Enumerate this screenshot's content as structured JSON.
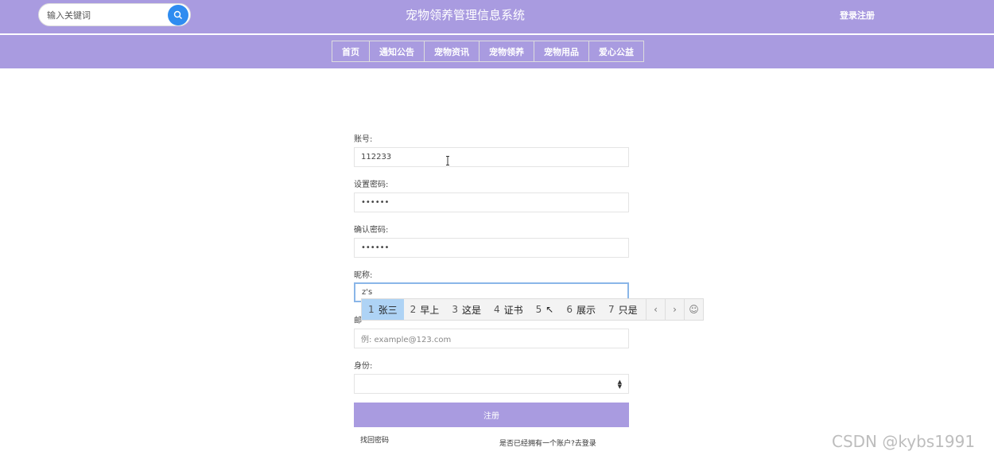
{
  "header": {
    "search_placeholder": "输入关键词",
    "title": "宠物领养管理信息系统",
    "login_register": "登录注册"
  },
  "nav": [
    "首页",
    "通知公告",
    "宠物资讯",
    "宠物领养",
    "宠物用品",
    "爱心公益"
  ],
  "form": {
    "account_label": "账号:",
    "account_value": "112233",
    "password_label": "设置密码:",
    "password_value": "••••••",
    "confirm_label": "确认密码:",
    "confirm_value": "••••••",
    "nickname_label": "昵称:",
    "nickname_value": "z's",
    "email_label": "邮",
    "email_placeholder": "例: example@123.com",
    "role_label": "身份:",
    "role_value": "",
    "submit_label": "注册",
    "forgot_link": "找回密码",
    "login_link": "是否已经拥有一个账户?去登录"
  },
  "ime": {
    "candidates": [
      {
        "num": "1",
        "text": "张三"
      },
      {
        "num": "2",
        "text": "早上"
      },
      {
        "num": "3",
        "text": "这是"
      },
      {
        "num": "4",
        "text": "证书"
      },
      {
        "num": "5",
        "text": "↖"
      },
      {
        "num": "6",
        "text": "展示"
      },
      {
        "num": "7",
        "text": "只是"
      }
    ],
    "prev": "‹",
    "next": "›",
    "emoji": "☺"
  },
  "watermark": "CSDN @kybs1991",
  "colors": {
    "header_bg": "#a99be0",
    "search_btn": "#2f8cf0",
    "ime_selected": "#aed3f5"
  }
}
